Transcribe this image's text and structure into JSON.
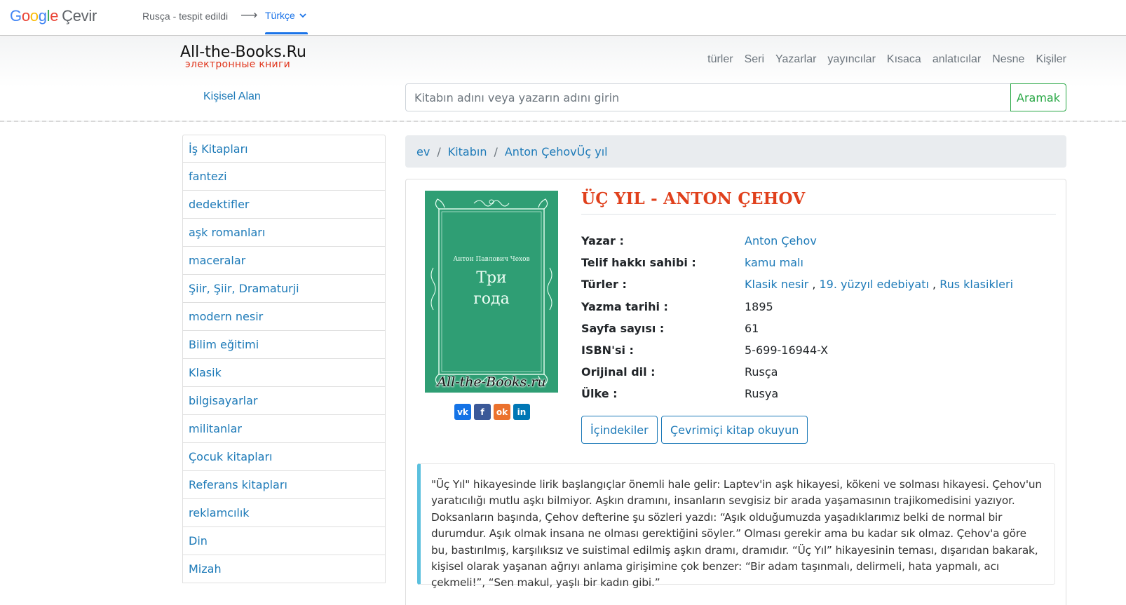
{
  "translate_bar": {
    "logo_letters": [
      "G",
      "o",
      "o",
      "g",
      "l",
      "e"
    ],
    "app_name": "Çevir",
    "source_language": "Rusça - tespit edildi",
    "arrow": "⟶",
    "target_language": "Türkçe"
  },
  "site": {
    "brand_title": "All-the-Books.Ru",
    "brand_subtitle": "электронные книги",
    "nav": [
      "türler",
      "Seri",
      "Yazarlar",
      "yayıncılar",
      "Kısaca",
      "anlatıcılar",
      "Nesne",
      "Kişiler"
    ],
    "personal_area": "Kişisel Alan",
    "search": {
      "placeholder": "Kitabın adını veya yazarın adını girin",
      "button": "Aramak"
    }
  },
  "sidebar": {
    "items": [
      "İş Kitapları",
      "fantezi",
      "dedektifler",
      "aşk romanları",
      "maceralar",
      "Şiir, Şiir, Dramaturji",
      "modern nesir",
      "Bilim eğitimi",
      "Klasik",
      "bilgisayarlar",
      "militanlar",
      "Çocuk kitapları",
      "Referans kitapları",
      "reklamcılık",
      "Din",
      "Mizah"
    ]
  },
  "breadcrumb": {
    "home": "ev",
    "section": "Kitabın",
    "current": "Anton ÇehovÜç yıl",
    "separator": "/"
  },
  "book": {
    "title": "ÜÇ YIL - ANTON ÇEHOV",
    "cover": {
      "author": "Антон Павлович Чехов",
      "title_line1": "Три",
      "title_line2": "года",
      "watermark": "All-the-Books.ru",
      "color": "#2f9e74"
    },
    "social": [
      "vk",
      "f",
      "ok",
      "in"
    ],
    "fields": {
      "author_label": "Yazar :",
      "author": "Anton Çehov",
      "copyright_label": "Telif hakkı sahibi :",
      "copyright": "kamu malı",
      "genres_label": "Türler :",
      "genre1": "Klasik nesir",
      "genre2": "19. yüzyıl edebiyatı",
      "genre3": "Rus klasikleri",
      "genre_sep": ",",
      "written_label": "Yazma tarihi :",
      "written": "1895",
      "pages_label": "Sayfa sayısı :",
      "pages": "61",
      "isbn_label": "ISBN'si :",
      "isbn": "5-699-16944-X",
      "language_label": "Orijinal dil :",
      "language": "Rusça",
      "country_label": "Ülke :",
      "country": "Rusya"
    },
    "buttons": {
      "contents": "İçindekiler",
      "read_online": "Çevrimiçi kitap okuyun"
    },
    "description": "\"Üç Yıl\" hikayesinde lirik başlangıçlar önemli hale gelir: Laptev'in aşk hikayesi, kökeni ve solması hikayesi. Çehov'un yaratıcılığı mutlu aşkı bilmiyor. Aşkın dramını, insanların sevgisiz bir arada yaşamasının trajikomedisini yazıyor. Doksanların başında, Çehov defterine şu sözleri yazdı: “Aşık olduğumuzda yaşadıklarımız belki de normal bir durumdur. Aşık olmak insana ne olması gerektiğini söyler.” Olması gerekir ama bu kadar sık olmaz. Çehov'a göre bu, bastırılmış, karşılıksız ve suistimal edilmiş aşkın dramı, dramıdır. “Üç Yıl” hikayesinin teması, dışarıdan bakarak, kişisel olarak yaşanan ağrıyı anlama girişimine çok benzer: “Bir adam taşınmalı, delirmeli, hata yapmalı, acı çekmeli!”, “Sen makul, yaşlı bir kadın gibi.”"
  }
}
